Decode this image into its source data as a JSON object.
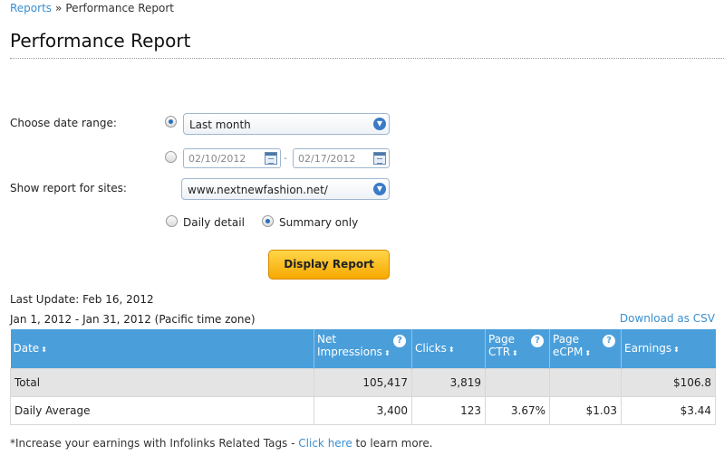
{
  "breadcrumb": {
    "parent": "Reports",
    "separator": "»",
    "current": "Performance Report"
  },
  "page_title": "Performance Report",
  "form": {
    "date_range_label": "Choose date range:",
    "date_range_selected": "Last month",
    "date_from_placeholder": "02/10/2012",
    "date_to_placeholder": "02/17/2012",
    "date_separator": "-",
    "sites_label": "Show report for sites:",
    "site_selected": "www.nextnewfashion.net/",
    "detail_options": [
      "Daily detail",
      "Summary only"
    ],
    "detail_selected": "Summary only",
    "submit_label": "Display Report"
  },
  "report": {
    "last_update": "Last Update: Feb 16, 2012",
    "period": "Jan 1, 2012 - Jan 31, 2012 (Pacific time zone)",
    "download_label": "Download as CSV",
    "columns": {
      "date": "Date",
      "impressions_1": "Net",
      "impressions_2": "Impressions",
      "clicks": "Clicks",
      "ctr_1": "Page",
      "ctr_2": "CTR",
      "ecpm_1": "Page",
      "ecpm_2": "eCPM",
      "earnings": "Earnings"
    },
    "sort_glyph": "⬍",
    "help_glyph": "?",
    "rows": {
      "total": {
        "date": "Total",
        "impressions": "105,417",
        "clicks": "3,819",
        "ctr": "",
        "ecpm": "",
        "earnings": "$106.8"
      },
      "average": {
        "date": "Daily Average",
        "impressions": "3,400",
        "clicks": "123",
        "ctr": "3.67%",
        "ecpm": "$1.03",
        "earnings": "$3.44"
      }
    }
  },
  "footer_note": {
    "prefix": "*Increase your earnings with Infolinks Related Tags - ",
    "link": "Click here",
    "suffix": " to learn more."
  },
  "colors": {
    "link": "#3a8fd0",
    "table_header": "#4a9fdb",
    "button": "#f7a800"
  }
}
